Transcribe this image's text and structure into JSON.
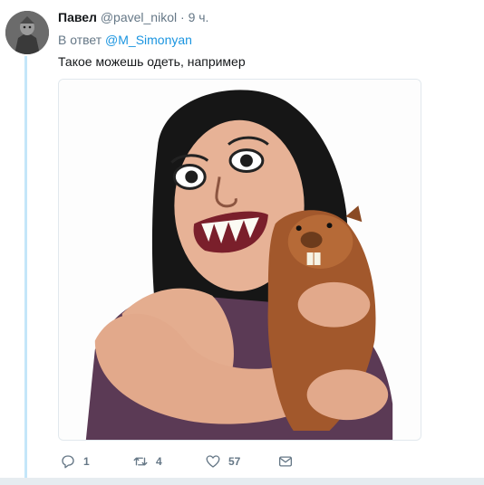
{
  "tweet": {
    "author_name": "Павел",
    "author_handle": "@pavel_nikol",
    "separator": "·",
    "time": "9 ч.",
    "reply_prefix": "В ответ",
    "reply_mention": "@M_Simonyan",
    "text": "Такое можешь одеть, например"
  },
  "media": {
    "alt": "",
    "description_icon": "caricature-image"
  },
  "actions": {
    "reply_count": "1",
    "retweet_count": "4",
    "like_count": "57"
  },
  "colors": {
    "link": "#1b95e0",
    "muted": "#657786",
    "thread_line": "#c4e6f9",
    "text": "#14171a"
  }
}
